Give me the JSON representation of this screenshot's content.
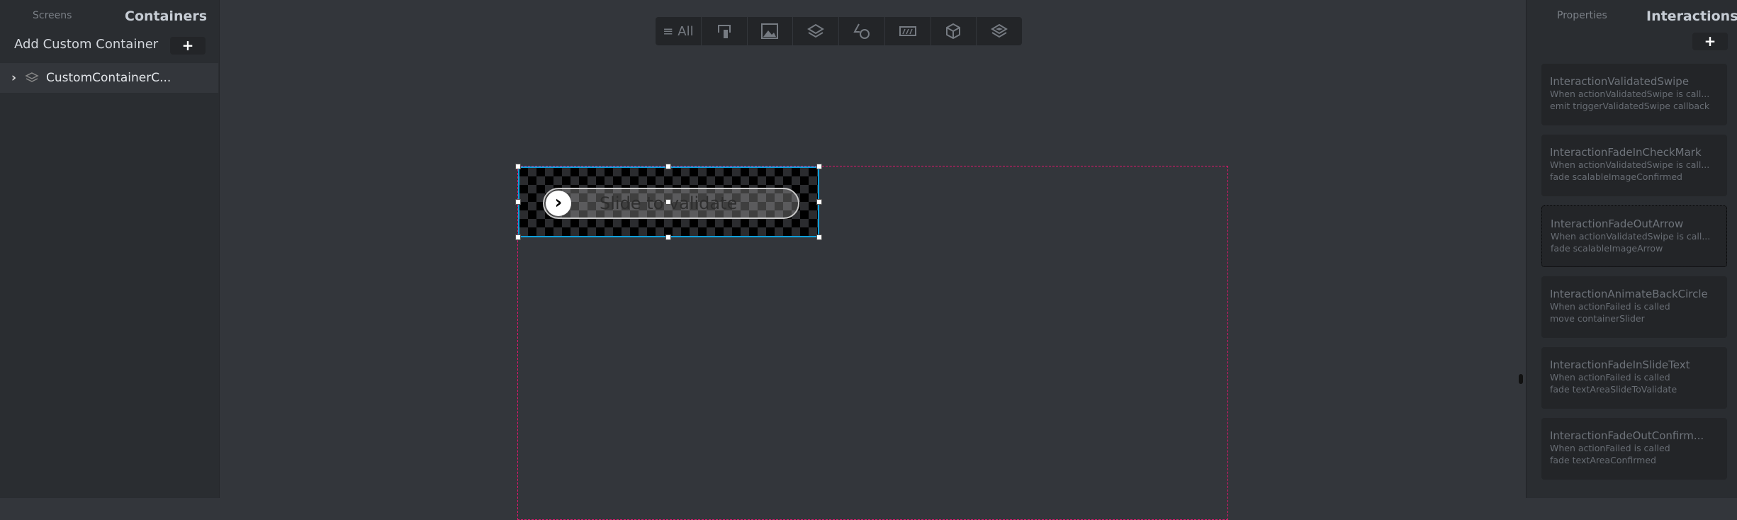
{
  "left_panel": {
    "tabs": [
      "Screens",
      "Containers"
    ],
    "active_tab": "Containers",
    "add_label": "Add Custom Container",
    "add_button": "+",
    "tree": [
      {
        "label": "CustomContainerC...",
        "icon": "layers-icon"
      }
    ]
  },
  "toolbar": {
    "items": [
      {
        "label": "All",
        "icon": "menu-icon"
      },
      {
        "icon": "touch-icon"
      },
      {
        "icon": "image-icon"
      },
      {
        "icon": "layers-icon"
      },
      {
        "icon": "shapes-icon"
      },
      {
        "icon": "progress-icon"
      },
      {
        "icon": "cube-icon"
      },
      {
        "icon": "stack-icon"
      }
    ]
  },
  "canvas": {
    "slider_text": "Slide to validate",
    "knob_glyph": "›"
  },
  "right_panel": {
    "tabs": [
      "Properties",
      "Interactions"
    ],
    "active_tab": "Interactions",
    "add_button": "+",
    "interactions": [
      {
        "title": "InteractionValidatedSwipe",
        "when": "When actionValidatedSwipe is call...",
        "then": "emit triggerValidatedSwipe callback"
      },
      {
        "title": "InteractionFadeInCheckMark",
        "when": "When actionValidatedSwipe is call...",
        "then": "fade scalableImageConfirmed"
      },
      {
        "title": "InteractionFadeOutArrow",
        "when": "When actionValidatedSwipe is call...",
        "then": "fade scalableImageArrow"
      },
      {
        "title": "InteractionAnimateBackCircle",
        "when": "When actionFailed is called",
        "then": "move containerSlider"
      },
      {
        "title": "InteractionFadeInSlideText",
        "when": "When actionFailed is called",
        "then": "fade textAreaSlideToValidate"
      },
      {
        "title": "InteractionFadeOutConfirm...",
        "when": "When actionFailed is called",
        "then": "fade textAreaConfirmed"
      }
    ]
  },
  "colors": {
    "selection": "#0ea0dc",
    "guide": "#e0166c"
  }
}
